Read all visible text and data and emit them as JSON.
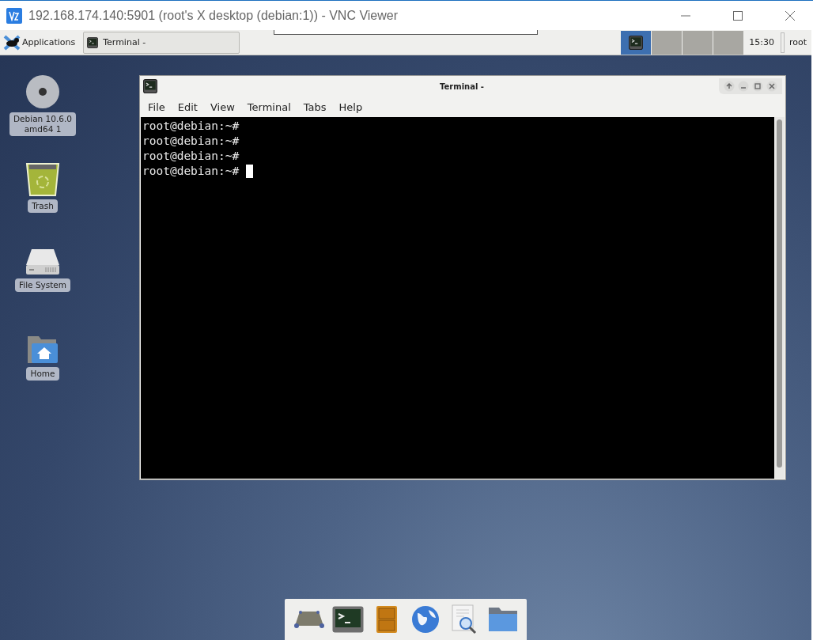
{
  "vnc_window": {
    "title": "192.168.174.140:5901 (root's X desktop (debian:1)) - VNC Viewer"
  },
  "panel": {
    "applications": "Applications",
    "tasks": [
      {
        "label": "Terminal -",
        "selected": false
      }
    ],
    "workspaces": [
      {
        "selected": true,
        "occupied": true
      },
      {
        "selected": false,
        "occupied": false
      },
      {
        "selected": false,
        "occupied": false
      },
      {
        "selected": false,
        "occupied": false
      }
    ],
    "clock": "15:30",
    "user": "root"
  },
  "desktop_icons": [
    {
      "kind": "disc",
      "label": "Debian 10.6.0\namd64 1"
    },
    {
      "kind": "trash",
      "label": "Trash"
    },
    {
      "kind": "drive",
      "label": "File System"
    },
    {
      "kind": "home",
      "label": "Home"
    }
  ],
  "terminal": {
    "title": "Terminal -",
    "menu": [
      "File",
      "Edit",
      "View",
      "Terminal",
      "Tabs",
      "Help"
    ],
    "lines": [
      "root@debian:~#",
      "root@debian:~#",
      "root@debian:~#",
      "root@debian:~#"
    ],
    "cursor": true
  },
  "dock": [
    {
      "kind": "monitor"
    },
    {
      "kind": "terminal"
    },
    {
      "kind": "cabinet"
    },
    {
      "kind": "globe"
    },
    {
      "kind": "search"
    },
    {
      "kind": "folder"
    }
  ]
}
